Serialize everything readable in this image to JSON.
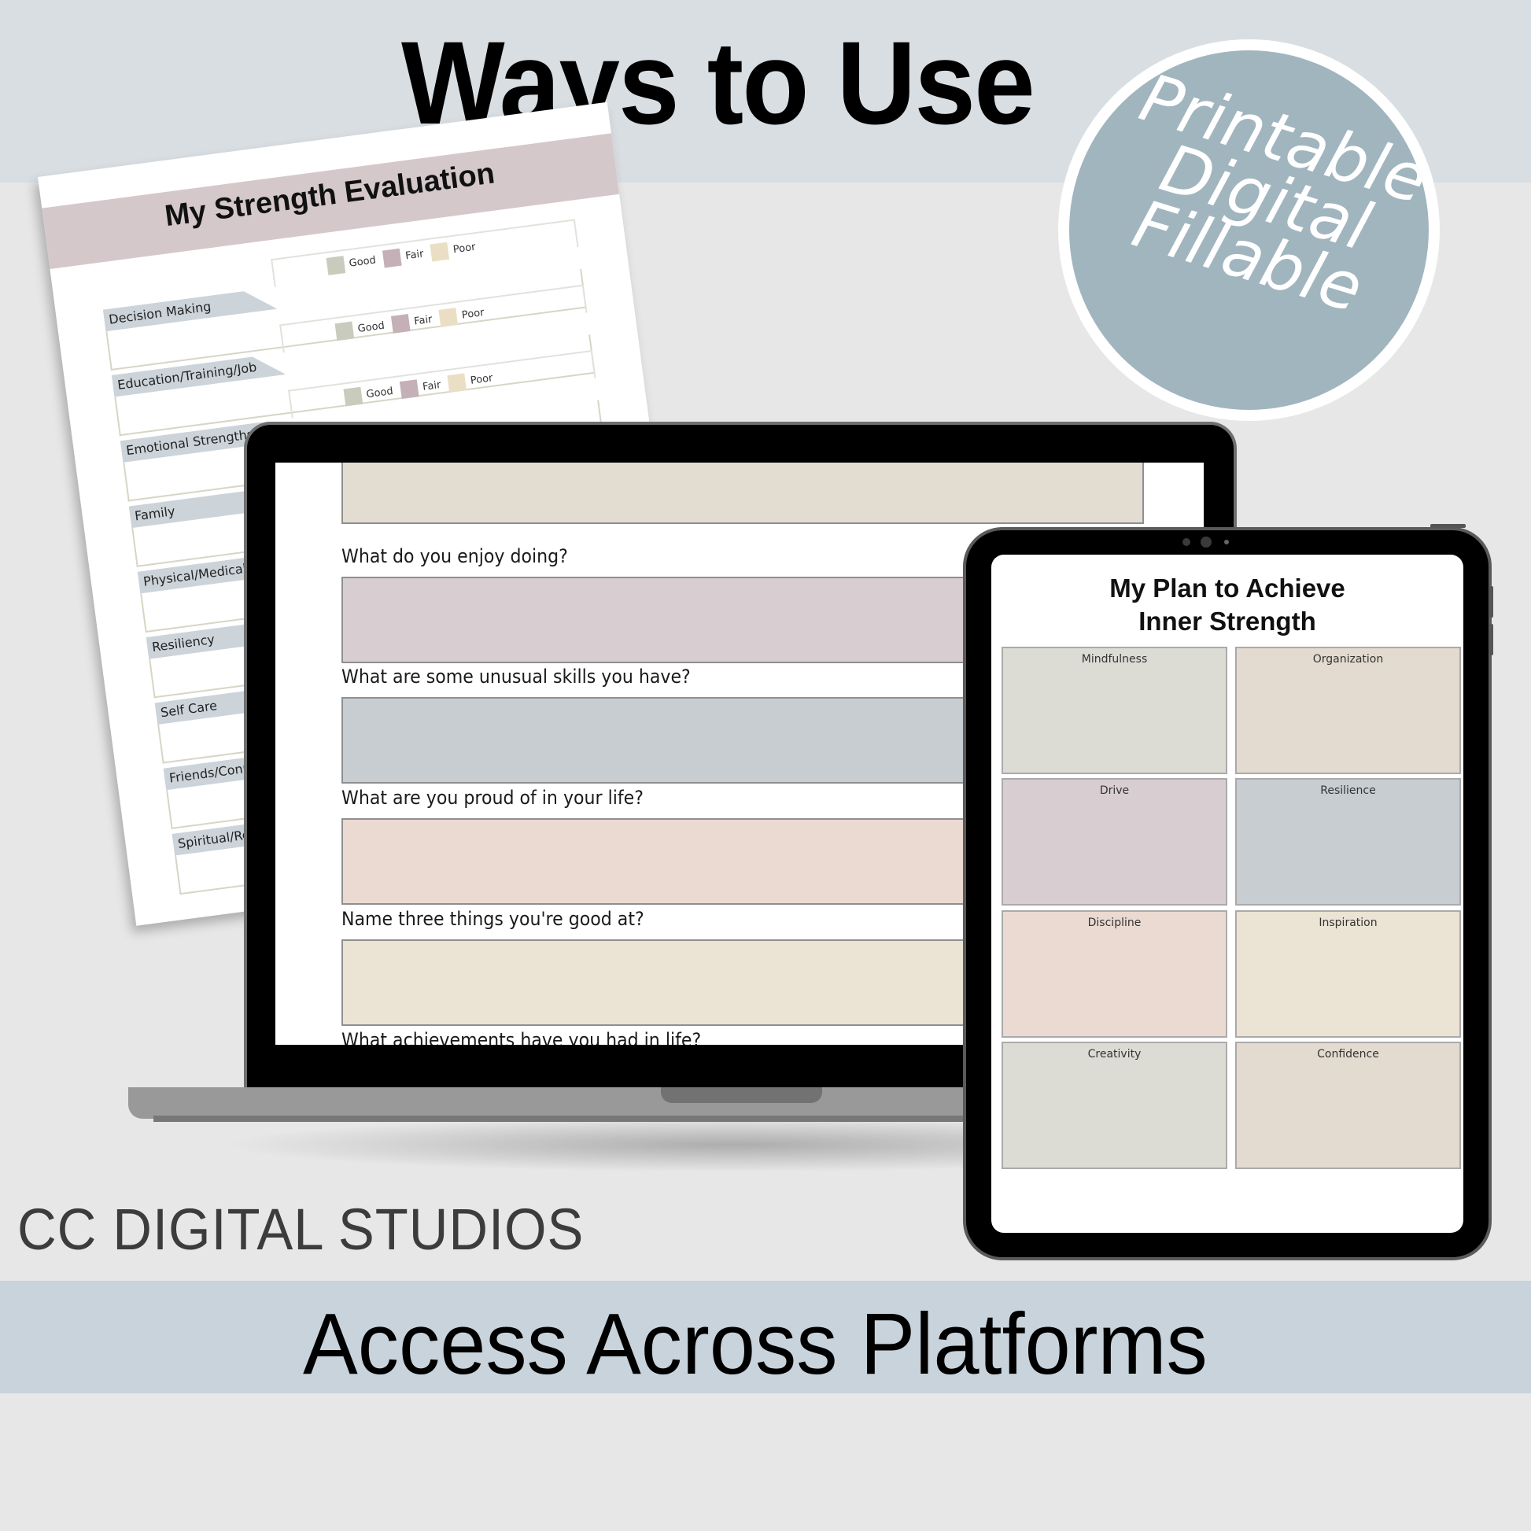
{
  "header": {
    "title": "Ways to Use"
  },
  "badge": {
    "lines": [
      "Printable",
      "Digital",
      "Fillable"
    ],
    "color": "#a1b5bf"
  },
  "paper": {
    "title": "My Strength Evaluation",
    "rating_options": [
      {
        "label": "Good",
        "color": "#c9cbbd"
      },
      {
        "label": "Fair",
        "color": "#c4b0b6"
      },
      {
        "label": "Poor",
        "color": "#eadfc4"
      }
    ],
    "categories": [
      "Decision Making",
      "Education/Training/Job",
      "Emotional Strengths",
      "Family",
      "Physical/Medical H",
      "Resiliency",
      "Self Care",
      "Friends/Conn",
      "Spiritual/Rel"
    ]
  },
  "laptop": {
    "questions": [
      {
        "label": "",
        "color": "#e3dcd0"
      },
      {
        "label": "What do you enjoy doing?",
        "color": "#d8ced1"
      },
      {
        "label": "What are some unusual skills you have?",
        "color": "#c7cdd1"
      },
      {
        "label": "What are you proud of in your life?",
        "color": "#ebdad2"
      },
      {
        "label": "Name three things you're good at?",
        "color": "#ebe3d4"
      },
      {
        "label": "What achievements have you had in life?",
        "color": ""
      }
    ]
  },
  "tablet": {
    "title_line1": "My Plan to Achieve",
    "title_line2": "Inner Strength",
    "cards": [
      {
        "label": "Mindfulness",
        "color": "#dcdcd5"
      },
      {
        "label": "Organization",
        "color": "#e3dbcf"
      },
      {
        "label": "Drive",
        "color": "#d8ced1"
      },
      {
        "label": "Resilience",
        "color": "#c7cdd1"
      },
      {
        "label": "Discipline",
        "color": "#ebdad2"
      },
      {
        "label": "Inspiration",
        "color": "#ebe3d4"
      },
      {
        "label": "Creativity",
        "color": "#dcdcd5"
      },
      {
        "label": "Confidence",
        "color": "#e3dbcf"
      }
    ]
  },
  "brand": "CC DIGITAL STUDIOS",
  "footer": {
    "title": "Access Across Platforms"
  }
}
